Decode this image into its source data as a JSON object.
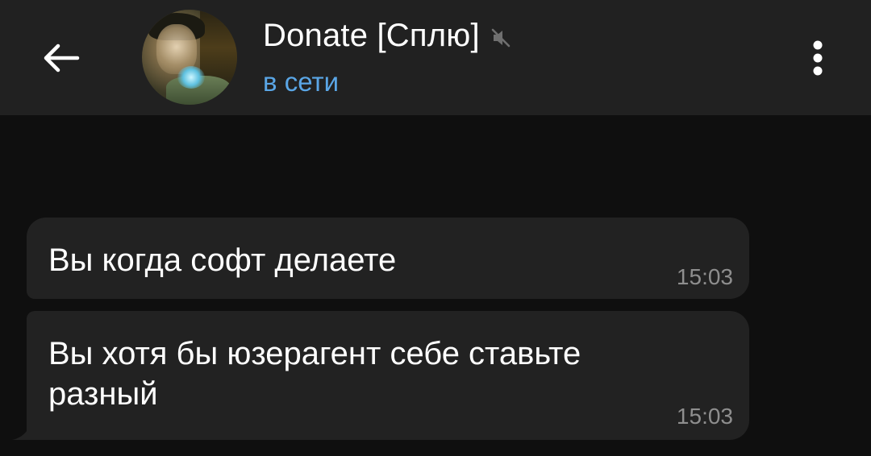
{
  "header": {
    "title": "Donate [Сплю]",
    "status": "в сети",
    "back_icon": "arrow-left-icon",
    "mute_icon": "muted-speaker-icon",
    "menu_icon": "more-vertical-icon"
  },
  "messages": [
    {
      "lines": [
        "Вы когда софт делаете"
      ],
      "time": "15:03"
    },
    {
      "lines": [
        "Вы хотя бы юзерагент себе ставьте",
        "разный"
      ],
      "time": "15:03"
    }
  ],
  "colors": {
    "header_bg": "#212121",
    "chat_bg": "#0f0f0f",
    "bubble_bg": "#222222",
    "status_accent": "#5aa6e6",
    "time_text": "#8e8e8e"
  }
}
